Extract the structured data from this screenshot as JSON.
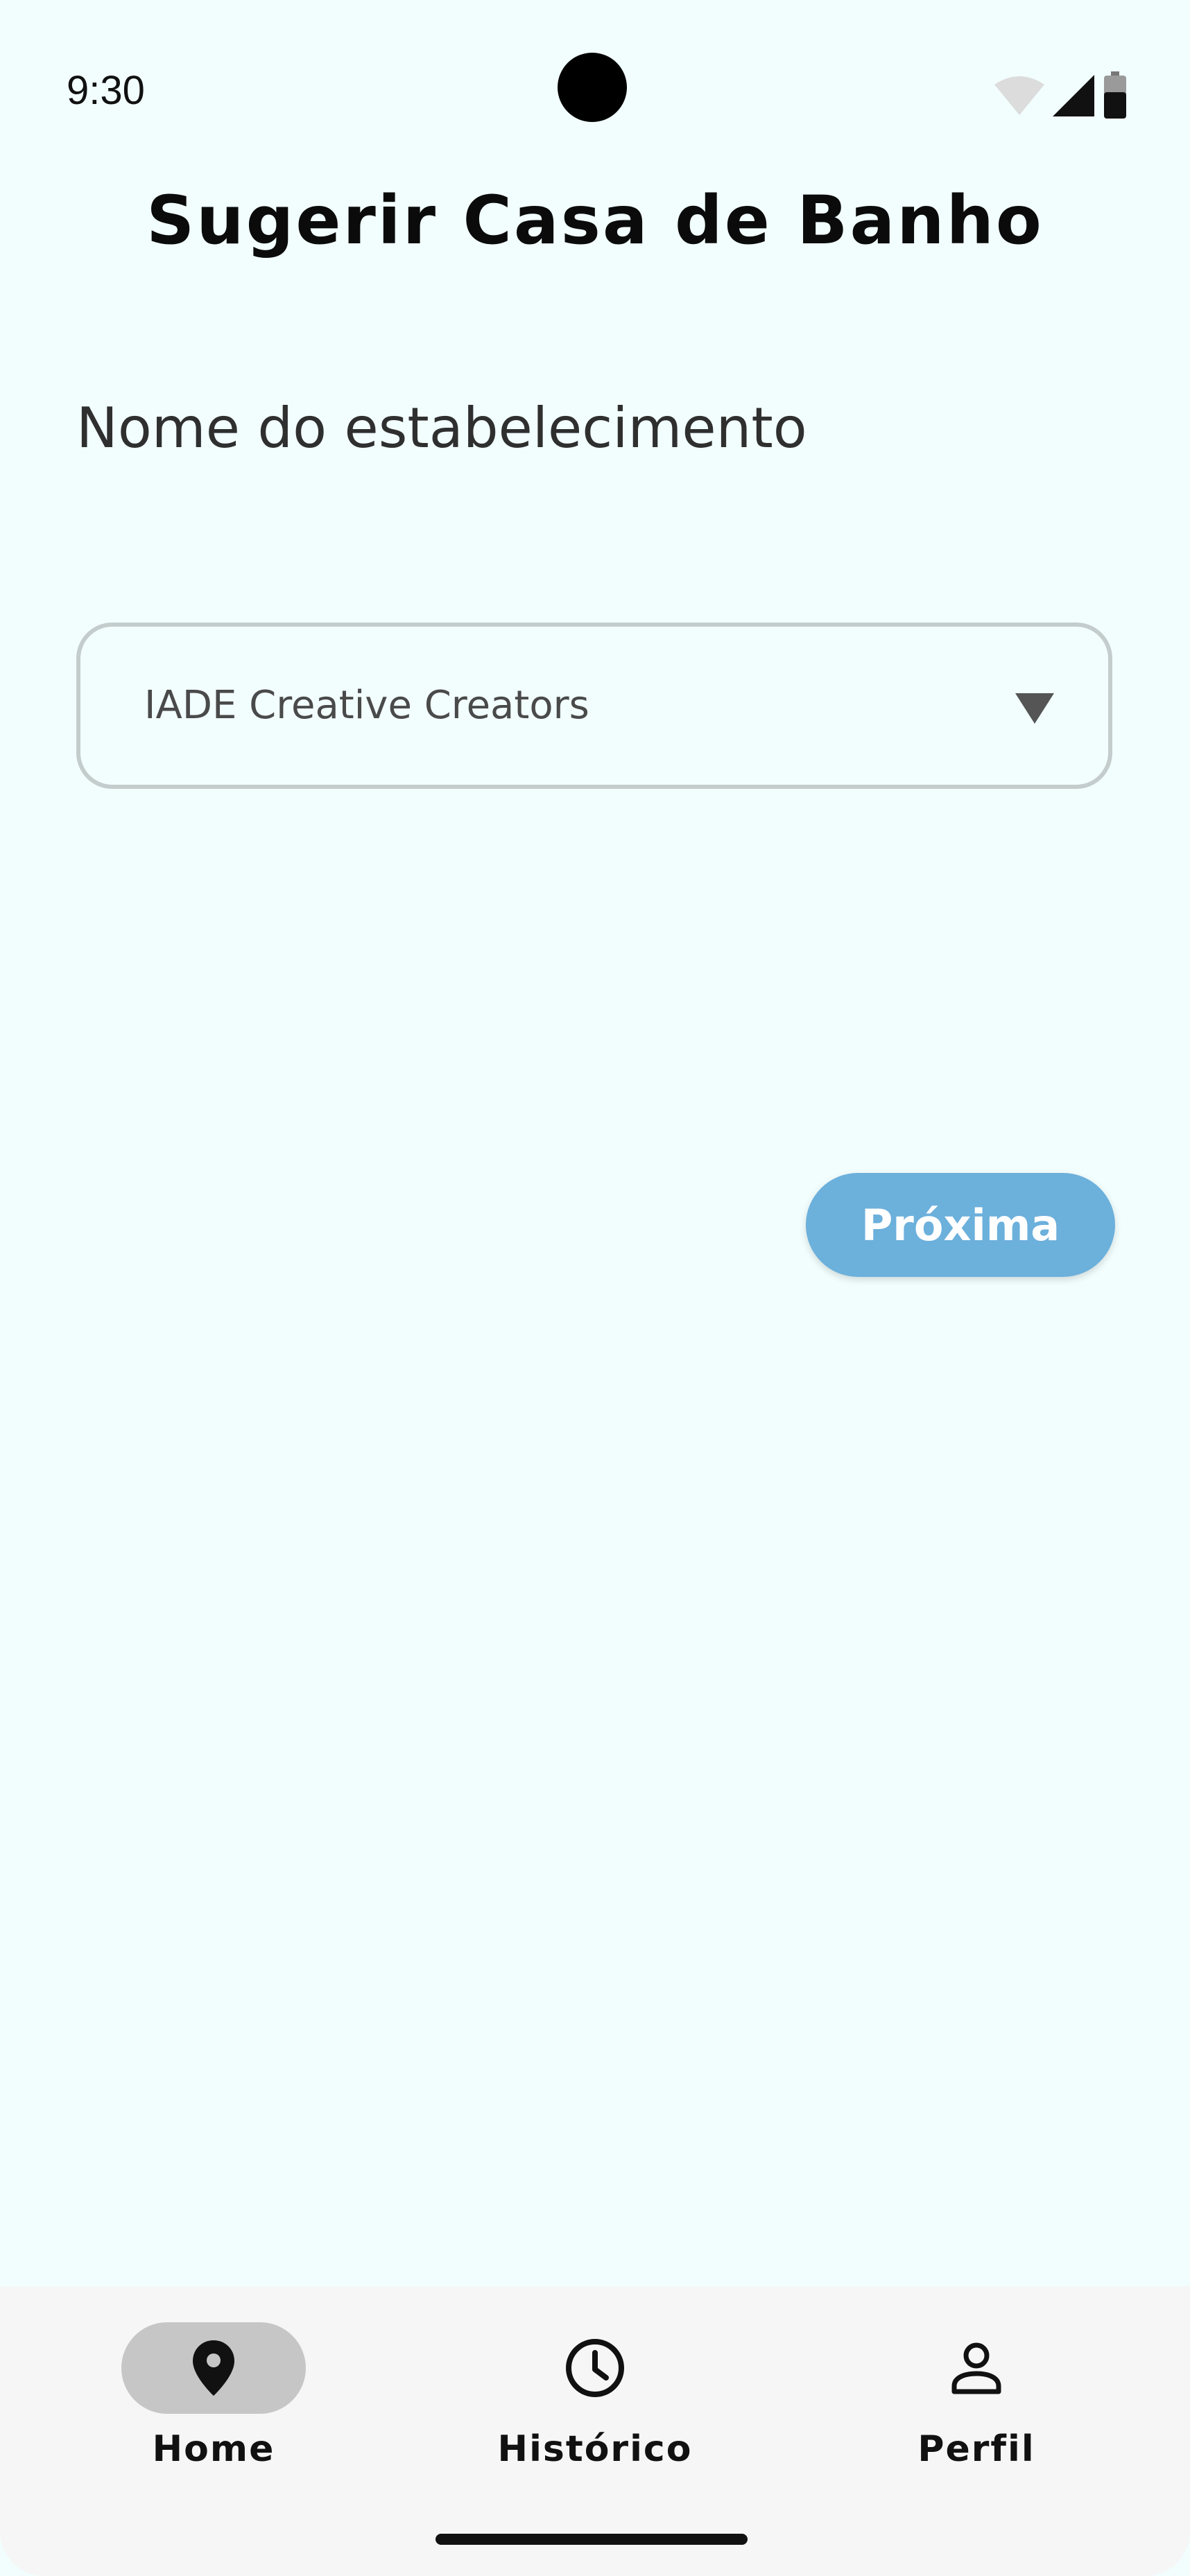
{
  "status_bar": {
    "time": "9:30",
    "icons": [
      "wifi-icon",
      "cellular-signal-icon",
      "battery-icon"
    ]
  },
  "page": {
    "title": "Sugerir Casa de Banho"
  },
  "form": {
    "establishment_label": "Nome do estabelecimento",
    "establishment_selected": "IADE Creative Creators",
    "next_label": "Próxima"
  },
  "bottom_nav": {
    "items": [
      {
        "label": "Home",
        "icon": "location-pin-icon",
        "active": true
      },
      {
        "label": "Histórico",
        "icon": "clock-icon",
        "active": false
      },
      {
        "label": "Perfil",
        "icon": "person-icon",
        "active": false
      }
    ]
  },
  "colors": {
    "background": "#f2fefe",
    "accent_button": "#6cb0dc",
    "active_nav_pill": "#c6c6c6",
    "dropdown_border": "#c4cccc"
  }
}
